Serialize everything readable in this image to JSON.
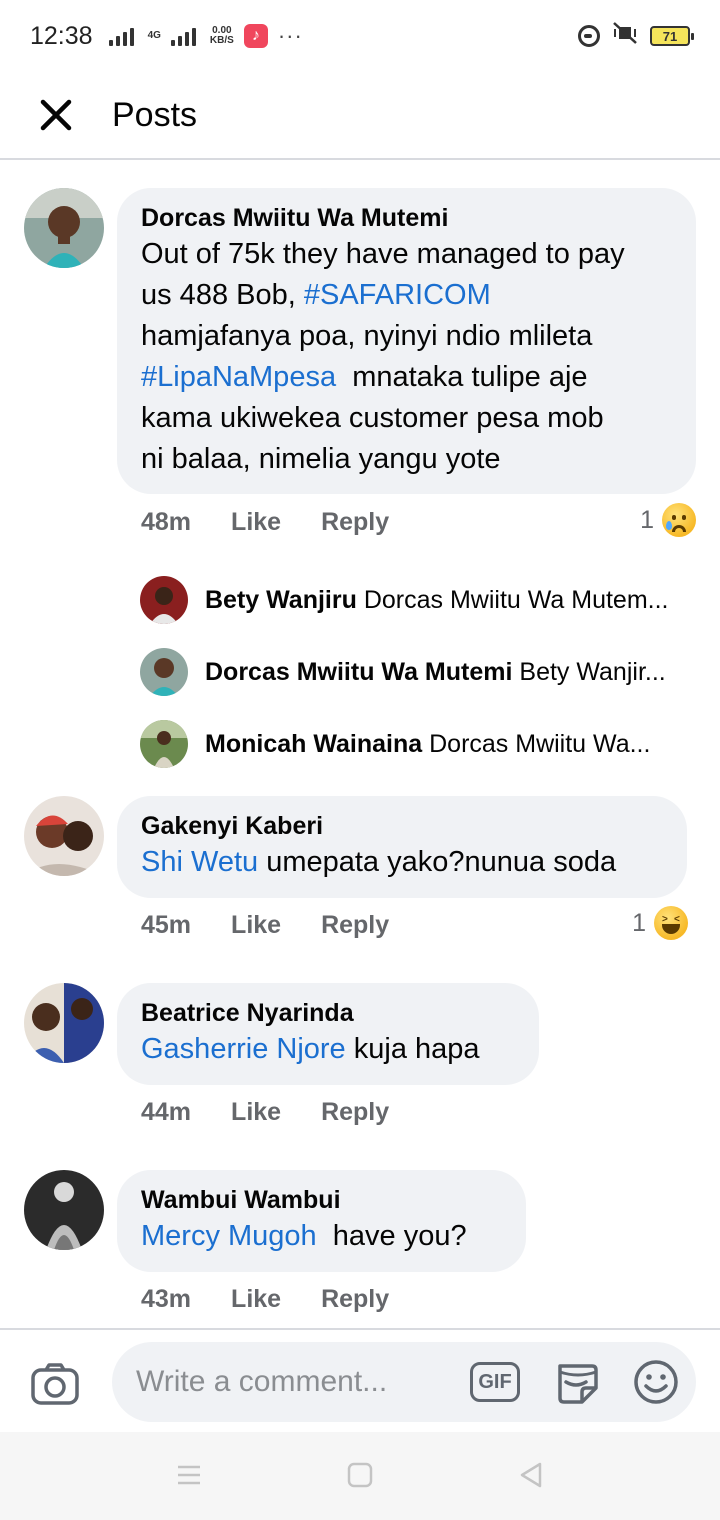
{
  "status_bar": {
    "time": "12:38",
    "network_type": "4G",
    "data_speed_value": "0.00",
    "data_speed_unit": "KB/S",
    "more_dots": "···",
    "battery_level": "71"
  },
  "header": {
    "title": "Posts"
  },
  "comments": [
    {
      "author": "Dorcas Mwiitu Wa Mutemi",
      "text_parts": [
        {
          "t": "Out of 75k they have managed to pay\nus 488 Bob, ",
          "mention": false
        },
        {
          "t": "#SAFARICOM",
          "mention": true
        },
        {
          "t": "\nhamjafanya poa, nyinyi ndio mlileta\n",
          "mention": false
        },
        {
          "t": "#LipaNaMpesa",
          "mention": true
        },
        {
          "t": "  mnataka tulipe aje\nkama ukiwekea customer pesa mob\nni balaa, nimelia yangu yote",
          "mention": false
        }
      ],
      "time": "48m",
      "like_label": "Like",
      "reply_label": "Reply",
      "reaction_count": "1",
      "reaction": "sad-emoji",
      "replies": [
        {
          "author": "Bety Wanjiru",
          "preview": "Dorcas Mwiitu Wa Mutem..."
        },
        {
          "author": "Dorcas Mwiitu Wa Mutemi",
          "preview": "Bety Wanjir..."
        },
        {
          "author": "Monicah Wainaina",
          "preview": "Dorcas Mwiitu Wa..."
        }
      ]
    },
    {
      "author": "Gakenyi Kaberi",
      "mention": "Shi Wetu",
      "text": " umepata yako?nunua soda",
      "time": "45m",
      "like_label": "Like",
      "reply_label": "Reply",
      "reaction_count": "1",
      "reaction": "laugh-emoji"
    },
    {
      "author": "Beatrice Nyarinda",
      "mention": "Gasherrie Njore",
      "text": " kuja hapa",
      "time": "44m",
      "like_label": "Like",
      "reply_label": "Reply"
    },
    {
      "author": "Wambui Wambui",
      "mention": "Mercy Mugoh",
      "text": "  have you?",
      "time": "43m",
      "like_label": "Like",
      "reply_label": "Reply"
    }
  ],
  "composer": {
    "placeholder": "Write a comment...",
    "gif_label": "GIF"
  },
  "colors": {
    "mention": "#1b6fd0",
    "bubble": "#f0f2f5",
    "secondary_text": "#65676b"
  }
}
